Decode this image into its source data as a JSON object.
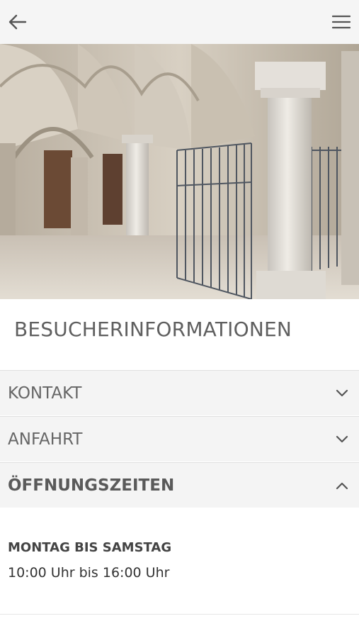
{
  "header": {
    "back_icon": "arrow-left-icon",
    "menu_icon": "hamburger-menu-icon"
  },
  "page": {
    "title": "BESUCHERINFORMATIONEN"
  },
  "accordion": [
    {
      "label": "KONTAKT",
      "expanded": false
    },
    {
      "label": "ANFAHRT",
      "expanded": false
    },
    {
      "label": "ÖFFNUNGSZEITEN",
      "expanded": true
    }
  ],
  "opening_hours": {
    "days": "MONTAG BIS SAMSTAG",
    "time": "10:00 Uhr bis 16:00 Uhr"
  },
  "colors": {
    "topbar": "#f5f5f5",
    "row_bg": "#f4f4f4",
    "text": "#666666"
  }
}
